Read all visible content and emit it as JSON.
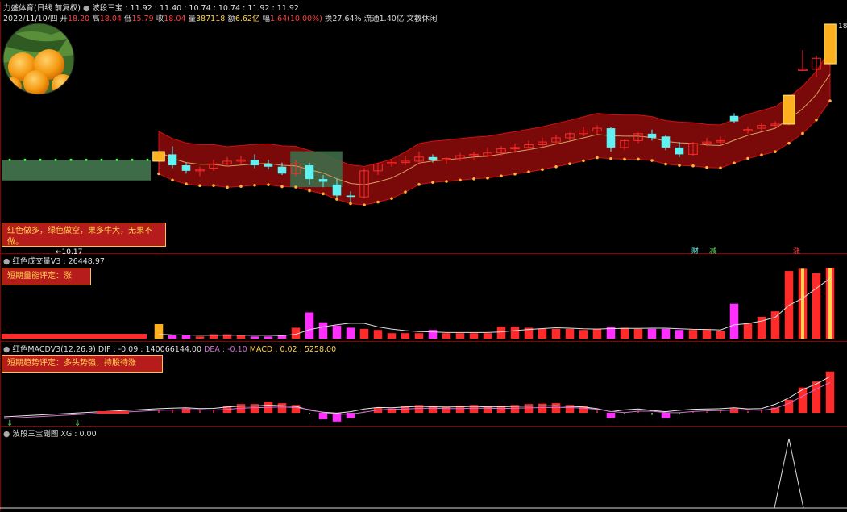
{
  "header": {
    "stock_title": "力盛体育(日线 前复权)",
    "indicator": "波段三宝 : 11.92 : 11.40 : 10.74 : 10.74 : 11.92 : 11.92",
    "date": "2022/11/10/四",
    "open_label": "开",
    "open": "18.20",
    "high_label": "高",
    "high": "18.04",
    "low_label": "低",
    "low": "15.79",
    "close_label": "收",
    "close": "18.04",
    "vol_label": "量",
    "vol": "387118",
    "amount_label": "额",
    "amount": "6.62亿",
    "chg_label": "幅",
    "chg": "1.64(10.00%)",
    "turnover": "换27.64%",
    "float_cap": "流通1.40亿",
    "industry": "文教休闲"
  },
  "price_panel": {
    "note_text": "红色做多，绿色做空，果多牛大，无果不做。",
    "low_marker": "←10.17",
    "high_marker": "18",
    "tag_cai": "财",
    "tag_jian": "减",
    "tag_zhang": "涨"
  },
  "volume_panel": {
    "title": "红色成交量V3 : 26448.97",
    "note_text": "短期量能评定：涨"
  },
  "macd_panel": {
    "title_prefix": "红色MACDV3(12,26,9) DIF : -0.09 : 140066144.00",
    "dea_label": "DEA : -0.10",
    "macd_label": "MACD : 0.02 : 5258.00",
    "note_text": "短期趋势评定：多头势强，持股待涨"
  },
  "sub_panel": {
    "title": "波段三宝副图 XG : 0.00"
  },
  "colors": {
    "up": "#ff2a2a",
    "down": "#5ff2f2",
    "band_red": "#7a0a0a",
    "band_green": "#3e6b48",
    "grid_line": "#8b0000",
    "dif": "#e8e8e8",
    "dea": "#d070d0"
  },
  "chart_data": {
    "type": "candlestick",
    "x_count": 50,
    "y_range": [
      10.17,
      18.04
    ],
    "candles": [
      {
        "o": 13.05,
        "h": 13.45,
        "l": 12.6,
        "c": 13.4
      },
      {
        "o": 13.3,
        "h": 13.6,
        "l": 12.8,
        "c": 12.9
      },
      {
        "o": 12.9,
        "h": 13.0,
        "l": 12.6,
        "c": 12.7
      },
      {
        "o": 12.7,
        "h": 12.85,
        "l": 12.5,
        "c": 12.75
      },
      {
        "o": 12.8,
        "h": 13.1,
        "l": 12.7,
        "c": 12.95
      },
      {
        "o": 12.95,
        "h": 13.2,
        "l": 12.85,
        "c": 13.05
      },
      {
        "o": 13.05,
        "h": 13.25,
        "l": 12.95,
        "c": 13.1
      },
      {
        "o": 13.1,
        "h": 13.3,
        "l": 12.8,
        "c": 12.9
      },
      {
        "o": 12.95,
        "h": 13.1,
        "l": 12.75,
        "c": 12.85
      },
      {
        "o": 12.85,
        "h": 13.0,
        "l": 12.55,
        "c": 12.6
      },
      {
        "o": 12.6,
        "h": 13.1,
        "l": 12.5,
        "c": 12.95
      },
      {
        "o": 12.9,
        "h": 13.0,
        "l": 12.2,
        "c": 12.4
      },
      {
        "o": 12.4,
        "h": 12.55,
        "l": 12.1,
        "c": 12.3
      },
      {
        "o": 12.2,
        "h": 12.4,
        "l": 11.7,
        "c": 11.8
      },
      {
        "o": 11.8,
        "h": 11.95,
        "l": 11.55,
        "c": 11.75
      },
      {
        "o": 11.75,
        "h": 12.8,
        "l": 11.7,
        "c": 12.7
      },
      {
        "o": 12.7,
        "h": 13.0,
        "l": 12.55,
        "c": 12.95
      },
      {
        "o": 12.95,
        "h": 13.1,
        "l": 12.85,
        "c": 13.0
      },
      {
        "o": 13.0,
        "h": 13.25,
        "l": 12.9,
        "c": 13.05
      },
      {
        "o": 13.05,
        "h": 13.4,
        "l": 12.95,
        "c": 13.2
      },
      {
        "o": 13.2,
        "h": 13.3,
        "l": 13.0,
        "c": 13.1
      },
      {
        "o": 13.1,
        "h": 13.2,
        "l": 12.95,
        "c": 13.15
      },
      {
        "o": 13.15,
        "h": 13.35,
        "l": 13.05,
        "c": 13.25
      },
      {
        "o": 13.25,
        "h": 13.4,
        "l": 13.1,
        "c": 13.3
      },
      {
        "o": 13.25,
        "h": 13.55,
        "l": 13.2,
        "c": 13.35
      },
      {
        "o": 13.35,
        "h": 13.6,
        "l": 13.25,
        "c": 13.5
      },
      {
        "o": 13.5,
        "h": 13.7,
        "l": 13.35,
        "c": 13.55
      },
      {
        "o": 13.55,
        "h": 13.8,
        "l": 13.45,
        "c": 13.65
      },
      {
        "o": 13.65,
        "h": 13.9,
        "l": 13.55,
        "c": 13.75
      },
      {
        "o": 13.75,
        "h": 14.0,
        "l": 13.65,
        "c": 13.9
      },
      {
        "o": 13.9,
        "h": 14.1,
        "l": 13.8,
        "c": 14.05
      },
      {
        "o": 14.05,
        "h": 14.3,
        "l": 13.95,
        "c": 14.15
      },
      {
        "o": 14.15,
        "h": 14.35,
        "l": 14.0,
        "c": 14.25
      },
      {
        "o": 14.25,
        "h": 14.3,
        "l": 13.4,
        "c": 13.55
      },
      {
        "o": 13.55,
        "h": 13.85,
        "l": 13.45,
        "c": 13.8
      },
      {
        "o": 13.8,
        "h": 14.1,
        "l": 13.7,
        "c": 14.05
      },
      {
        "o": 14.05,
        "h": 14.2,
        "l": 13.8,
        "c": 13.9
      },
      {
        "o": 13.95,
        "h": 14.0,
        "l": 13.45,
        "c": 13.55
      },
      {
        "o": 13.55,
        "h": 13.75,
        "l": 13.2,
        "c": 13.3
      },
      {
        "o": 13.3,
        "h": 13.75,
        "l": 13.25,
        "c": 13.7
      },
      {
        "o": 13.7,
        "h": 13.9,
        "l": 13.6,
        "c": 13.75
      },
      {
        "o": 13.75,
        "h": 13.95,
        "l": 13.65,
        "c": 13.8
      },
      {
        "o": 14.7,
        "h": 14.8,
        "l": 14.45,
        "c": 14.5
      },
      {
        "o": 14.2,
        "h": 14.3,
        "l": 14.05,
        "c": 14.2
      },
      {
        "o": 14.25,
        "h": 14.45,
        "l": 14.15,
        "c": 14.35
      },
      {
        "o": 14.35,
        "h": 14.5,
        "l": 14.25,
        "c": 14.4
      },
      {
        "o": 14.4,
        "h": 15.45,
        "l": 14.35,
        "c": 15.45
      },
      {
        "o": 16.4,
        "h": 17.1,
        "l": 16.35,
        "c": 16.4
      },
      {
        "o": 16.4,
        "h": 16.9,
        "l": 16.1,
        "c": 16.8
      },
      {
        "o": 16.6,
        "h": 18.04,
        "l": 16.5,
        "c": 18.04
      }
    ],
    "volume": [
      4,
      3,
      3,
      2,
      4,
      4,
      3,
      2,
      2,
      3,
      10,
      24,
      15,
      12,
      10,
      9,
      8,
      5,
      5,
      5,
      8,
      5,
      5,
      5,
      5,
      11,
      11,
      10,
      9,
      9,
      9,
      8,
      9,
      11,
      10,
      9,
      9,
      9,
      8,
      8,
      8,
      7,
      32,
      14,
      20,
      25,
      62,
      64,
      60,
      65
    ],
    "macd_bars": [
      0.5,
      0.8,
      1.0,
      0.6,
      0.7,
      1.5,
      2.0,
      2.0,
      2.5,
      2.2,
      1.8,
      -0.3,
      -1.5,
      -2.0,
      -1.2,
      0.3,
      1.2,
      1.0,
      1.5,
      1.8,
      1.6,
      1.4,
      1.6,
      1.8,
      1.5,
      1.6,
      1.8,
      2.0,
      2.1,
      2.2,
      1.8,
      1.5,
      0.5,
      -1.2,
      -0.2,
      0.3,
      -0.5,
      -1.2,
      -0.4,
      0.2,
      0.3,
      0.5,
      1.0,
      0.4,
      0.6,
      1.2,
      3.0,
      5.8,
      7.2,
      9.5
    ],
    "xg_spike_index": 46
  }
}
